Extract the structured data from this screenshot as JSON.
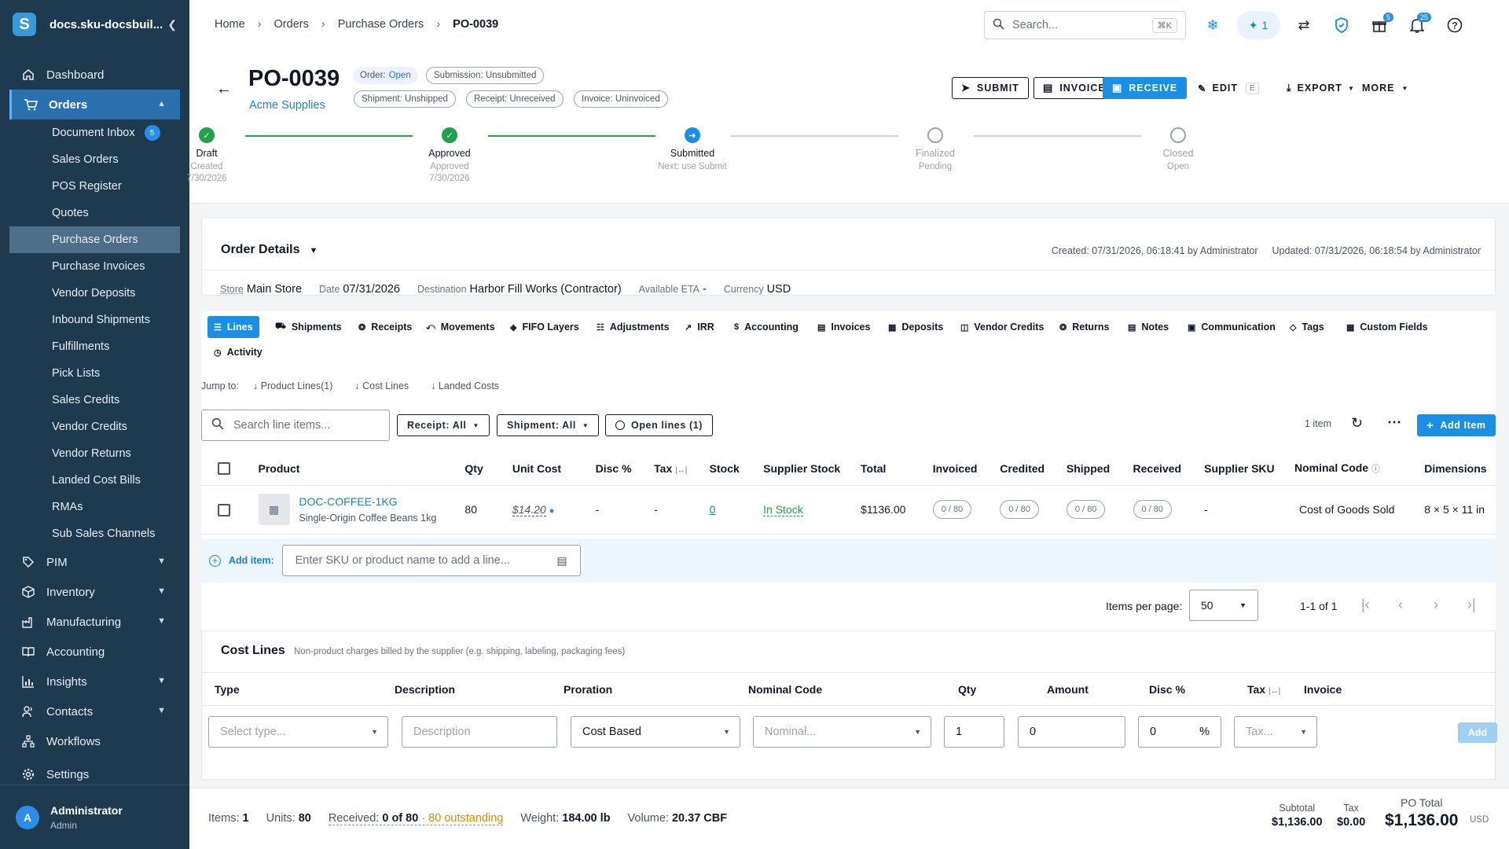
{
  "app": {
    "org_name": "docs.sku-docsbuil...",
    "logo_letter": "S"
  },
  "sidebar": {
    "items": [
      {
        "label": "Dashboard",
        "icon": "home-icon"
      },
      {
        "label": "Orders",
        "icon": "cart-icon"
      },
      {
        "label": "PIM",
        "icon": "tag-icon"
      },
      {
        "label": "Inventory",
        "icon": "box-icon"
      },
      {
        "label": "Manufacturing",
        "icon": "factory-icon"
      },
      {
        "label": "Accounting",
        "icon": "book-icon"
      },
      {
        "label": "Insights",
        "icon": "chart-icon"
      },
      {
        "label": "Contacts",
        "icon": "contacts-icon"
      },
      {
        "label": "Workflows",
        "icon": "workflow-icon"
      },
      {
        "label": "Settings",
        "icon": "gear-icon"
      }
    ],
    "orders_sub": [
      {
        "label": "Document Inbox",
        "badge": "5"
      },
      {
        "label": "Sales Orders"
      },
      {
        "label": "POS Register"
      },
      {
        "label": "Quotes"
      },
      {
        "label": "Purchase Orders"
      },
      {
        "label": "Purchase Invoices"
      },
      {
        "label": "Vendor Deposits"
      },
      {
        "label": "Inbound Shipments"
      },
      {
        "label": "Fulfillments"
      },
      {
        "label": "Pick Lists"
      },
      {
        "label": "Sales Credits"
      },
      {
        "label": "Vendor Credits"
      },
      {
        "label": "Vendor Returns"
      },
      {
        "label": "Landed Cost Bills"
      },
      {
        "label": "RMAs"
      },
      {
        "label": "Sub Sales Channels"
      }
    ],
    "user": {
      "name": "Administrator",
      "role": "Admin",
      "initial": "A"
    }
  },
  "topbar": {
    "breadcrumbs": [
      "Home",
      "Orders",
      "Purchase Orders",
      "PO-0039"
    ],
    "search_placeholder": "Search...",
    "search_shortcut": "⌘K",
    "ai_count": "1",
    "gift_badge": "5",
    "notif_badge": "25"
  },
  "po": {
    "number": "PO-0039",
    "vendor": "Acme Supplies",
    "chips": {
      "order_label": "Order:",
      "order_value": "Open",
      "submission": "Submission: Unsubmitted",
      "shipment": "Shipment: Unshipped",
      "receipt": "Receipt: Unreceived",
      "invoice": "Invoice: Uninvoiced"
    },
    "actions": {
      "submit": "SUBMIT",
      "invoice": "INVOICE",
      "receive": "RECEIVE",
      "edit": "EDIT",
      "edit_key": "E",
      "export": "EXPORT",
      "more": "MORE"
    },
    "steps": [
      {
        "label": "Draft",
        "sub1": "Created",
        "sub2": "7/30/2026",
        "state": "done"
      },
      {
        "label": "Approved",
        "sub1": "Approved",
        "sub2": "7/30/2026",
        "state": "done"
      },
      {
        "label": "Submitted",
        "sub1": "Next: use Submit",
        "sub2": "",
        "state": "current"
      },
      {
        "label": "Finalized",
        "sub1": "Pending",
        "sub2": "",
        "state": "todo"
      },
      {
        "label": "Closed",
        "sub1": "Open",
        "sub2": "",
        "state": "todo"
      }
    ]
  },
  "order_details": {
    "title": "Order Details",
    "created": "Created: 07/31/2026, 06:18:41 by Administrator",
    "updated": "Updated: 07/31/2026, 06:18:54 by Administrator",
    "store_label": "Store",
    "store": "Main Store",
    "date_label": "Date",
    "date": "07/31/2026",
    "dest_label": "Destination",
    "dest": "Harbor Fill Works (Contractor)",
    "eta_label": "Available ETA",
    "eta": "-",
    "currency_label": "Currency",
    "currency": "USD"
  },
  "tabs": [
    "Lines",
    "Shipments",
    "Receipts",
    "Movements",
    "FIFO Layers",
    "Adjustments",
    "IRR",
    "Accounting",
    "Invoices",
    "Deposits",
    "Vendor Credits",
    "Returns",
    "Notes",
    "Communication",
    "Tags",
    "Custom Fields",
    "Activity"
  ],
  "jump": {
    "label": "Jump to:",
    "links": [
      "Product Lines(1)",
      "Cost Lines",
      "Landed Costs"
    ]
  },
  "lines_toolbar": {
    "search_placeholder": "Search line items...",
    "receipt_filter": "Receipt: All",
    "shipment_filter": "Shipment: All",
    "open_lines": "Open lines (1)",
    "count": "1 item",
    "add_item": "Add Item"
  },
  "lines_table": {
    "headers": [
      "Product",
      "Qty",
      "Unit Cost",
      "Disc %",
      "Tax",
      "Stock",
      "Supplier Stock",
      "Total",
      "Invoiced",
      "Credited",
      "Shipped",
      "Received",
      "Supplier SKU",
      "Nominal Code",
      "Dimensions"
    ],
    "rows": [
      {
        "sku": "DOC-COFFEE-1KG",
        "name": "Single-Origin Coffee Beans 1kg",
        "qty": "80",
        "unit_cost": "$14.20",
        "disc": "-",
        "tax": "-",
        "stock": "0",
        "supplier_stock": "In Stock",
        "total": "$1136.00",
        "invoiced": "0 / 80",
        "credited": "0 / 80",
        "shipped": "0 / 80",
        "received": "0 / 80",
        "supplier_sku": "-",
        "nominal": "Cost of Goods Sold",
        "dims": "8 × 5 × 11 in"
      }
    ]
  },
  "add_line": {
    "label": "Add item:",
    "placeholder": "Enter SKU or product name to add a line..."
  },
  "pager": {
    "label": "Items per page:",
    "size": "50",
    "range": "1-1 of 1"
  },
  "cost_lines": {
    "title": "Cost Lines",
    "subtitle": "Non-product charges billed by the supplier (e.g. shipping, labeling, packaging fees)",
    "headers": [
      "Type",
      "Description",
      "Proration",
      "Nominal Code",
      "Qty",
      "Amount",
      "Disc %",
      "Tax",
      "Invoice"
    ],
    "type_placeholder": "Select type...",
    "desc_placeholder": "Description",
    "proration": "Cost Based",
    "nominal_placeholder": "Nominal...",
    "qty": "1",
    "amount": "0",
    "disc": "0",
    "disc_unit": "%",
    "tax_placeholder": "Tax...",
    "add": "Add"
  },
  "footer": {
    "items_label": "Items:",
    "items": "1",
    "units_label": "Units:",
    "units": "80",
    "received_label": "Received:",
    "received": "0 of 80",
    "outstanding": "· 80 outstanding",
    "weight_label": "Weight:",
    "weight": "184.00 lb",
    "volume_label": "Volume:",
    "volume": "20.37 CBF",
    "subtotal_label": "Subtotal",
    "subtotal": "$1,136.00",
    "tax_label": "Tax",
    "tax": "$0.00",
    "total_label": "PO Total",
    "total": "$1,136.00",
    "currency": "USD"
  },
  "colors": {
    "accent": "#1a8fe3",
    "sidebar": "#1e3a4f",
    "success": "#22a04b",
    "warning": "#e08a00"
  }
}
